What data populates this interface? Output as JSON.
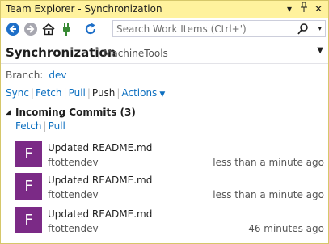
{
  "window": {
    "title": "Team Explorer - Synchronization",
    "controls": {
      "dropdown": "▾",
      "pin": "🖈",
      "close": "✕"
    }
  },
  "toolbar": {
    "icons": [
      "back-icon",
      "forward-icon",
      "home-icon",
      "connect-icon",
      "refresh-icon"
    ],
    "search": {
      "placeholder": "Search Work Items (Ctrl+')",
      "value": ""
    }
  },
  "header": {
    "title": "Synchronization",
    "separator": "|",
    "repo": "MachineTools"
  },
  "branch": {
    "label": "Branch:",
    "value": "dev"
  },
  "actions": {
    "sync": "Sync",
    "fetch": "Fetch",
    "pull": "Pull",
    "push": "Push",
    "actions": "Actions",
    "sep": "|"
  },
  "incoming": {
    "title": "Incoming Commits (3)",
    "fetch": "Fetch",
    "pull": "Pull",
    "sep": "|",
    "commits": [
      {
        "initial": "F",
        "message": "Updated README.md",
        "author": "ftottendev",
        "time": "less than a minute ago"
      },
      {
        "initial": "F",
        "message": "Updated README.md",
        "author": "ftottendev",
        "time": "less than a minute ago"
      },
      {
        "initial": "F",
        "message": "Updated README.md",
        "author": "ftottendev",
        "time": "46 minutes ago"
      }
    ]
  },
  "colors": {
    "title_bar": "#fff29d",
    "link": "#0e70c0",
    "avatar": "#7b2a86"
  }
}
